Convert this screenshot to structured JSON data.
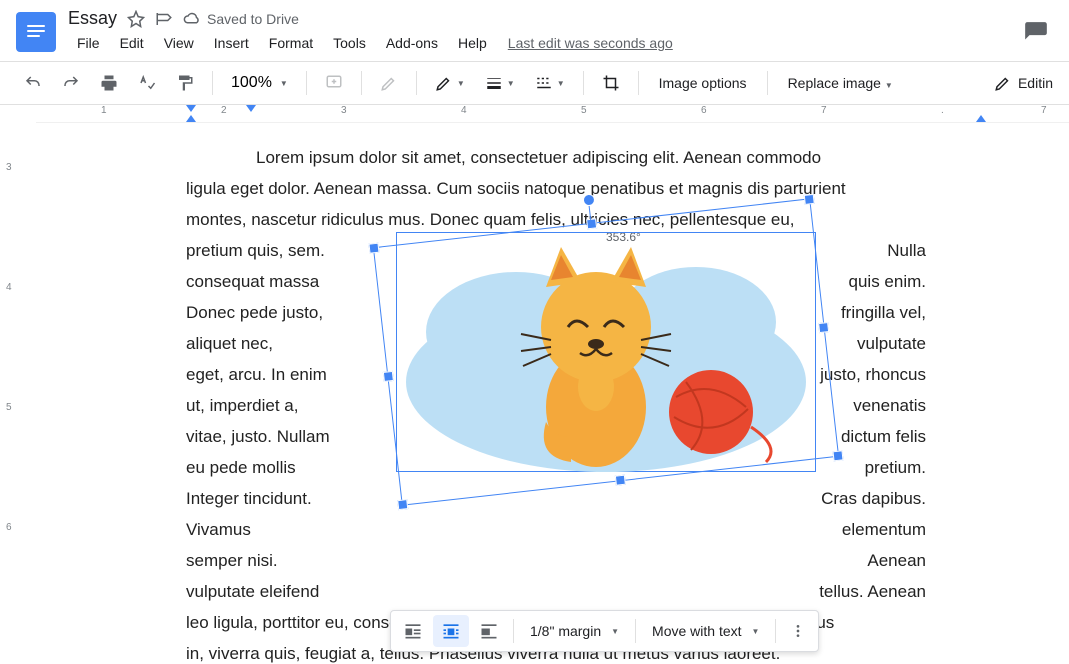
{
  "header": {
    "doc_title": "Essay",
    "saved_text": "Saved to Drive",
    "last_edit": "Last edit was seconds ago",
    "menus": [
      "File",
      "Edit",
      "View",
      "Insert",
      "Format",
      "Tools",
      "Add-ons",
      "Help"
    ]
  },
  "toolbar": {
    "zoom": "100%",
    "image_options": "Image options",
    "replace_image": "Replace image",
    "editing": "Editin"
  },
  "ruler": {
    "h_majors": [
      "1",
      "2",
      "3",
      "4",
      "5",
      "6",
      "7"
    ],
    "v_majors": [
      "3",
      "4",
      "5",
      "6"
    ]
  },
  "document": {
    "first_line": "Lorem ipsum dolor sit amet, consectetuer adipiscing elit. Aenean commodo",
    "line2": "ligula eget dolor. Aenean massa. Cum sociis natoque penatibus et magnis dis parturient",
    "line3": "montes, nascetur ridiculus mus. Donec quam felis, ultricies nec, pellentesque eu,",
    "wrap_left": [
      "pretium quis, sem.",
      "consequat massa",
      "Donec pede justo,",
      "aliquet nec,",
      "eget, arcu. In enim",
      "ut, imperdiet a,",
      "vitae, justo. Nullam",
      "eu pede mollis",
      "Integer tincidunt.",
      "Vivamus",
      "semper nisi.",
      "vulputate eleifend"
    ],
    "wrap_right": [
      "Nulla",
      "quis enim.",
      "fringilla vel,",
      "vulputate",
      "justo, rhoncus",
      "venenatis",
      "dictum felis",
      "pretium.",
      "Cras dapibus.",
      "elementum",
      "Aenean",
      "tellus. Aenean"
    ],
    "line_after1": "leo ligula, porttitor eu, consequat vitae, eleifend ac, enim. Aliquam lorem ante, dapibus",
    "line_after2": "in, viverra quis, feugiat a, tellus. Phasellus viverra nulla ut metus varius laoreet."
  },
  "image": {
    "rotation_angle": "353.6°"
  },
  "image_bar": {
    "margin": "1/8\" margin",
    "move": "Move with text"
  }
}
